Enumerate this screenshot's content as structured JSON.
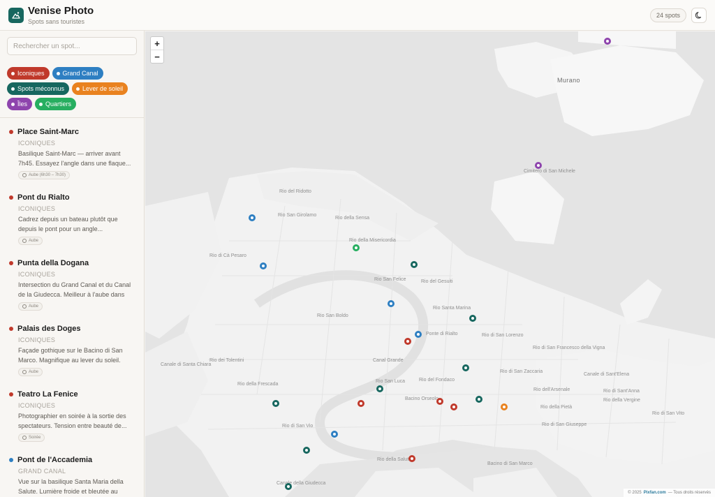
{
  "header": {
    "title": "Venise Photo",
    "subtitle": "Spots sans touristes",
    "spot_count": "24 spots",
    "theme_icon": "moon-icon",
    "logo_icon": "camera-mountain-icon"
  },
  "search": {
    "placeholder": "Rechercher un spot..."
  },
  "filters": [
    {
      "label": "Iconiques",
      "color": "#c0392b"
    },
    {
      "label": "Grand Canal",
      "color": "#2e7fc2"
    },
    {
      "label": "Spots méconnus",
      "color": "#17675f"
    },
    {
      "label": "Lever de soleil",
      "color": "#e9821f"
    },
    {
      "label": "Îles",
      "color": "#8e44ad"
    },
    {
      "label": "Quartiers",
      "color": "#27ae60"
    }
  ],
  "spots": [
    {
      "title": "Place Saint-Marc",
      "category": "ICONIQUES",
      "color": "#c0392b",
      "description": "Basilique Saint-Marc — arriver avant 7h45. Essayez l'angle dans une flaque...",
      "tag": "Aube (6h30 – 7h30)"
    },
    {
      "title": "Pont du Rialto",
      "category": "ICONIQUES",
      "color": "#c0392b",
      "description": "Cadrez depuis un bateau plutôt que depuis le pont pour un angle...",
      "tag": "Aube"
    },
    {
      "title": "Punta della Dogana",
      "category": "ICONIQUES",
      "color": "#c0392b",
      "description": "Intersection du Grand Canal et du Canal de la Giudecca. Meilleur à l'aube dans la...",
      "tag": "Aube"
    },
    {
      "title": "Palais des Doges",
      "category": "ICONIQUES",
      "color": "#c0392b",
      "description": "Façade gothique sur le Bacino di San Marco. Magnifique au lever du soleil.",
      "tag": "Aube"
    },
    {
      "title": "Teatro La Fenice",
      "category": "ICONIQUES",
      "color": "#c0392b",
      "description": "Photographier en soirée à la sortie des spectateurs. Tension entre beauté de...",
      "tag": "Soirée"
    },
    {
      "title": "Pont de l'Accademia",
      "category": "GRAND CANAL",
      "color": "#2e7fc2",
      "description": "Vue sur la basilique Santa Maria della Salute. Lumière froide et bleutée au lever...",
      "tag": ""
    }
  ],
  "map": {
    "zoom_in": "+",
    "zoom_out": "−",
    "attribution_prefix": "© 2025",
    "attribution_brand": "Pixfan.com",
    "attribution_suffix": "— Tous droits réservés",
    "labels": [
      {
        "text": "Murano",
        "big": true
      },
      {
        "text": "Cimitero di San Michele"
      },
      {
        "text": "Rio del Ridotto"
      },
      {
        "text": "Rio San Girolamo"
      },
      {
        "text": "Rio della Sensa"
      },
      {
        "text": "Rio della Misericordia"
      },
      {
        "text": "Rio di Cà Pesaro"
      },
      {
        "text": "Rio San Felice"
      },
      {
        "text": "Rio del Gesuiti"
      },
      {
        "text": "Rio Santa Marina"
      },
      {
        "text": "Rio San Boldo"
      },
      {
        "text": "Ponte di Rialto"
      },
      {
        "text": "Rio di San Lorenzo"
      },
      {
        "text": "Rio di San Francesco della Vigna"
      },
      {
        "text": "Canale di Santa Chiara"
      },
      {
        "text": "Rio dei Tolentini"
      },
      {
        "text": "Canal Grande"
      },
      {
        "text": "Rio della Frescada"
      },
      {
        "text": "Rio di San Zaccaria"
      },
      {
        "text": "Rio San Luca"
      },
      {
        "text": "Rio del Fondaco"
      },
      {
        "text": "Bacino Orseolo"
      },
      {
        "text": "Rio dell'Arsenale"
      },
      {
        "text": "Rio della Pietà"
      },
      {
        "text": "Rio della Vergine"
      },
      {
        "text": "Rio di San Giuseppe"
      },
      {
        "text": "Rio di San Vio"
      },
      {
        "text": "Rio della Salute"
      },
      {
        "text": "Bacino di San Marco"
      },
      {
        "text": "Canale di Sant'Elena"
      },
      {
        "text": "Rio di Sant'Anna"
      },
      {
        "text": "Rio di San Vito"
      },
      {
        "text": "Canale della Giudecca"
      }
    ],
    "markers": [
      {
        "color": "#8e44ad",
        "name": "isola-san-michele"
      },
      {
        "color": "#8e44ad",
        "name": "murano"
      },
      {
        "color": "#2e7fc2",
        "name": "grand-canal-1"
      },
      {
        "color": "#2e7fc2",
        "name": "grand-canal-2"
      },
      {
        "color": "#2e7fc2",
        "name": "grand-canal-3"
      },
      {
        "color": "#2e7fc2",
        "name": "grand-canal-4"
      },
      {
        "color": "#2e7fc2",
        "name": "pont-accademia"
      },
      {
        "color": "#27ae60",
        "name": "quartier-cannaregio"
      },
      {
        "color": "#17675f",
        "name": "spot-meconnu-1"
      },
      {
        "color": "#17675f",
        "name": "spot-meconnu-2"
      },
      {
        "color": "#17675f",
        "name": "spot-meconnu-3"
      },
      {
        "color": "#17675f",
        "name": "spot-meconnu-4"
      },
      {
        "color": "#17675f",
        "name": "spot-meconnu-5"
      },
      {
        "color": "#17675f",
        "name": "spot-meconnu-6"
      },
      {
        "color": "#17675f",
        "name": "spot-meconnu-7"
      },
      {
        "color": "#17675f",
        "name": "spot-meconnu-8"
      },
      {
        "color": "#c0392b",
        "name": "pont-rialto"
      },
      {
        "color": "#c0392b",
        "name": "teatro-la-fenice"
      },
      {
        "color": "#c0392b",
        "name": "place-saint-marc"
      },
      {
        "color": "#c0392b",
        "name": "palais-des-doges"
      },
      {
        "color": "#c0392b",
        "name": "punta-della-dogana"
      },
      {
        "color": "#e9821f",
        "name": "lever-soleil-riva"
      }
    ]
  }
}
